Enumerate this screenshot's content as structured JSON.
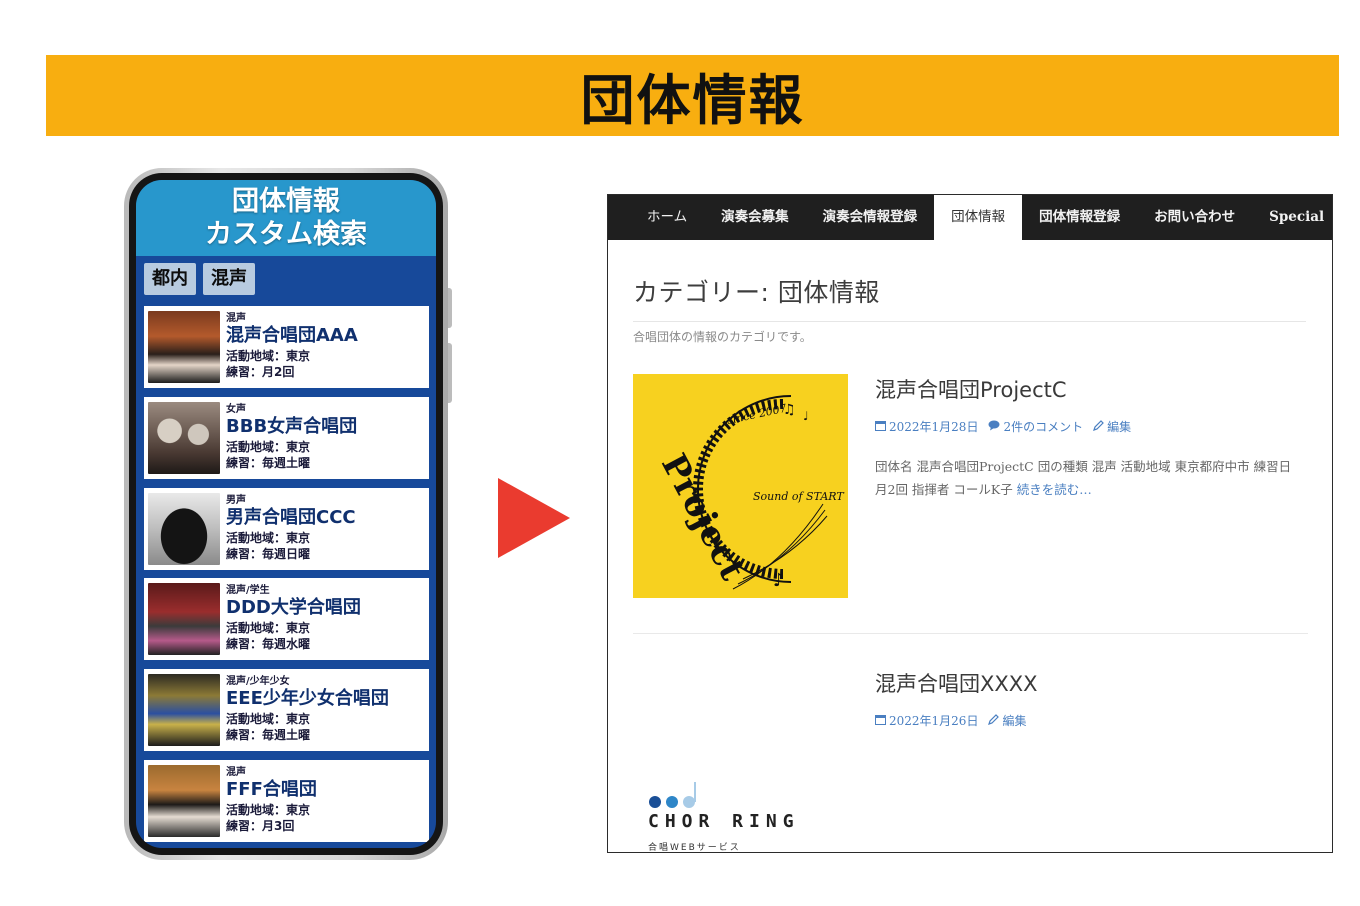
{
  "banner": {
    "title": "団体情報"
  },
  "phone": {
    "header_line1": "団体情報",
    "header_line2": "カスタム検索",
    "filters": [
      "都内",
      "混声"
    ],
    "choirs": [
      {
        "type": "混声",
        "name": "混声合唱団AAA",
        "area": "活動地域：東京",
        "practice": "練習：月2回"
      },
      {
        "type": "女声",
        "name": "BBB女声合唱団",
        "area": "活動地域：東京",
        "practice": "練習：毎週土曜"
      },
      {
        "type": "男声",
        "name": "男声合唱団CCC",
        "area": "活動地域：東京",
        "practice": "練習：毎週日曜"
      },
      {
        "type": "混声/学生",
        "name": "DDD大学合唱団",
        "area": "活動地域：東京",
        "practice": "練習：毎週水曜"
      },
      {
        "type": "混声/少年少女",
        "name": "EEE少年少女合唱団",
        "area": "活動地域：東京",
        "practice": "練習：毎週土曜"
      },
      {
        "type": "混声",
        "name": "FFF合唱団",
        "area": "活動地域：東京",
        "practice": "練習：月3回"
      }
    ]
  },
  "site": {
    "nav": [
      "ホーム",
      "演奏会募集",
      "演奏会情報登録",
      "団体情報",
      "団体情報登録",
      "お問い合わせ",
      "Special"
    ],
    "category_title": "カテゴリー: 団体情報",
    "category_desc": "合唱団体の情報のカテゴリです。",
    "posts": [
      {
        "title": "混声合唱団ProjectC",
        "date": "2022年1月28日",
        "comments": "2件のコメント",
        "edit": "編集",
        "excerpt": "団体名 混声合唱団ProjectC 団の種類 混声 活動地域 東京都府中市 練習日 月2回 指揮者 コールK子",
        "read_more": "続きを読む…",
        "logo": {
          "since": "since 2007",
          "word": "Project",
          "tagline": "Sound of START"
        }
      },
      {
        "title": "混声合唱団XXXX",
        "date": "2022年1月26日",
        "edit": "編集",
        "logo": {
          "word": "CHOR RING",
          "sub": "合唱WEBサービス"
        }
      }
    ]
  },
  "colors": {
    "banner": "#f8ae10",
    "phone_header": "#2897cc",
    "phone_bg": "#17499a",
    "arrow": "#ea3b2f",
    "nav_bg": "#1f1f1f",
    "link": "#4a7fc1",
    "logo_yellow": "#f7d11f"
  }
}
